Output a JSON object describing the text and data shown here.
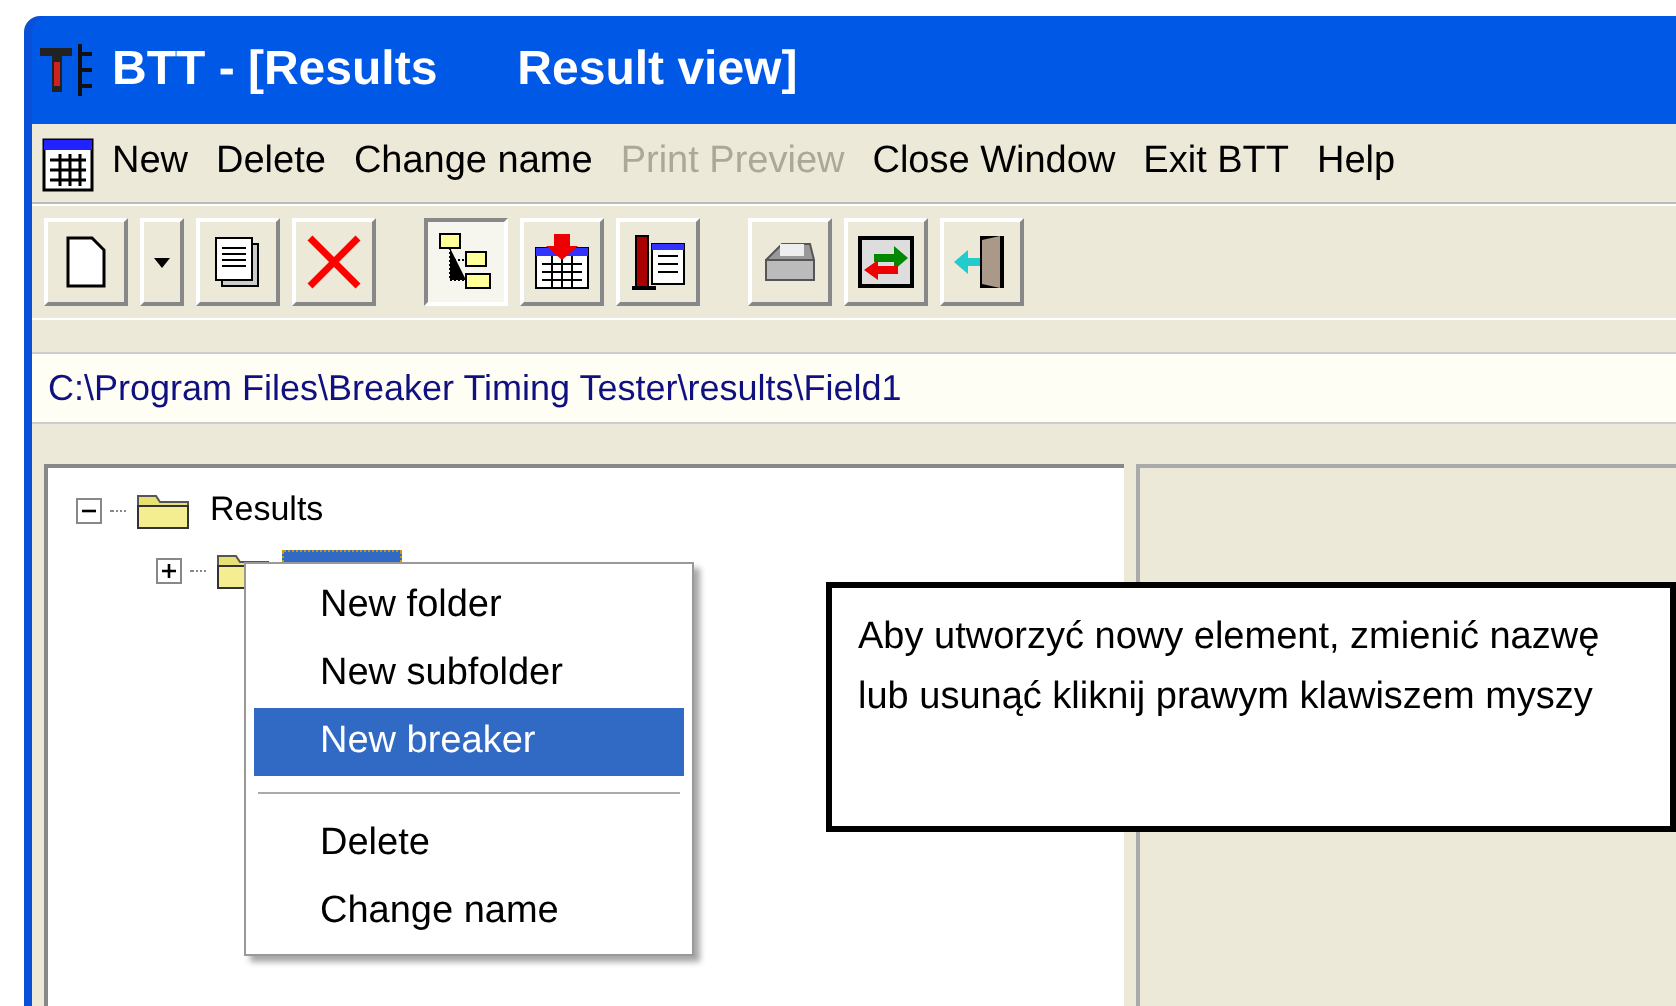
{
  "window": {
    "title": "BTT - [Results      Result view]"
  },
  "menu": [
    {
      "label": "New",
      "disabled": false
    },
    {
      "label": "Delete",
      "disabled": false
    },
    {
      "label": "Change name",
      "disabled": false
    },
    {
      "label": "Print Preview",
      "disabled": true
    },
    {
      "label": "Close Window",
      "disabled": false
    },
    {
      "label": "Exit BTT",
      "disabled": false
    },
    {
      "label": "Help",
      "disabled": false
    }
  ],
  "toolbar": [
    {
      "kind": "new",
      "pressed": false
    },
    {
      "kind": "dropdown",
      "pressed": false
    },
    {
      "kind": "save",
      "pressed": false
    },
    {
      "kind": "delete",
      "pressed": false
    },
    {
      "kind": "gap"
    },
    {
      "kind": "tree",
      "pressed": true
    },
    {
      "kind": "import",
      "pressed": false
    },
    {
      "kind": "breaker",
      "pressed": false
    },
    {
      "kind": "gap"
    },
    {
      "kind": "print",
      "pressed": false
    },
    {
      "kind": "exchange",
      "pressed": false
    },
    {
      "kind": "exit",
      "pressed": false
    }
  ],
  "path": "C:\\Program Files\\Breaker Timing Tester\\results\\Field1",
  "tree": [
    {
      "label": "Results",
      "expanded": true,
      "children": [
        {
          "expanded": false,
          "selected": true
        }
      ]
    }
  ],
  "context_menu": [
    {
      "kind": "item",
      "label": "New folder",
      "selected": false
    },
    {
      "kind": "item",
      "label": "New subfolder",
      "selected": false
    },
    {
      "kind": "item",
      "label": "New breaker",
      "selected": true
    },
    {
      "kind": "separator"
    },
    {
      "kind": "item",
      "label": "Delete",
      "selected": false
    },
    {
      "kind": "item",
      "label": "Change name",
      "selected": false
    }
  ],
  "hint": "Aby utworzyć nowy element, zmienić nazwę lub usunąć kliknij prawym klawiszem myszy"
}
